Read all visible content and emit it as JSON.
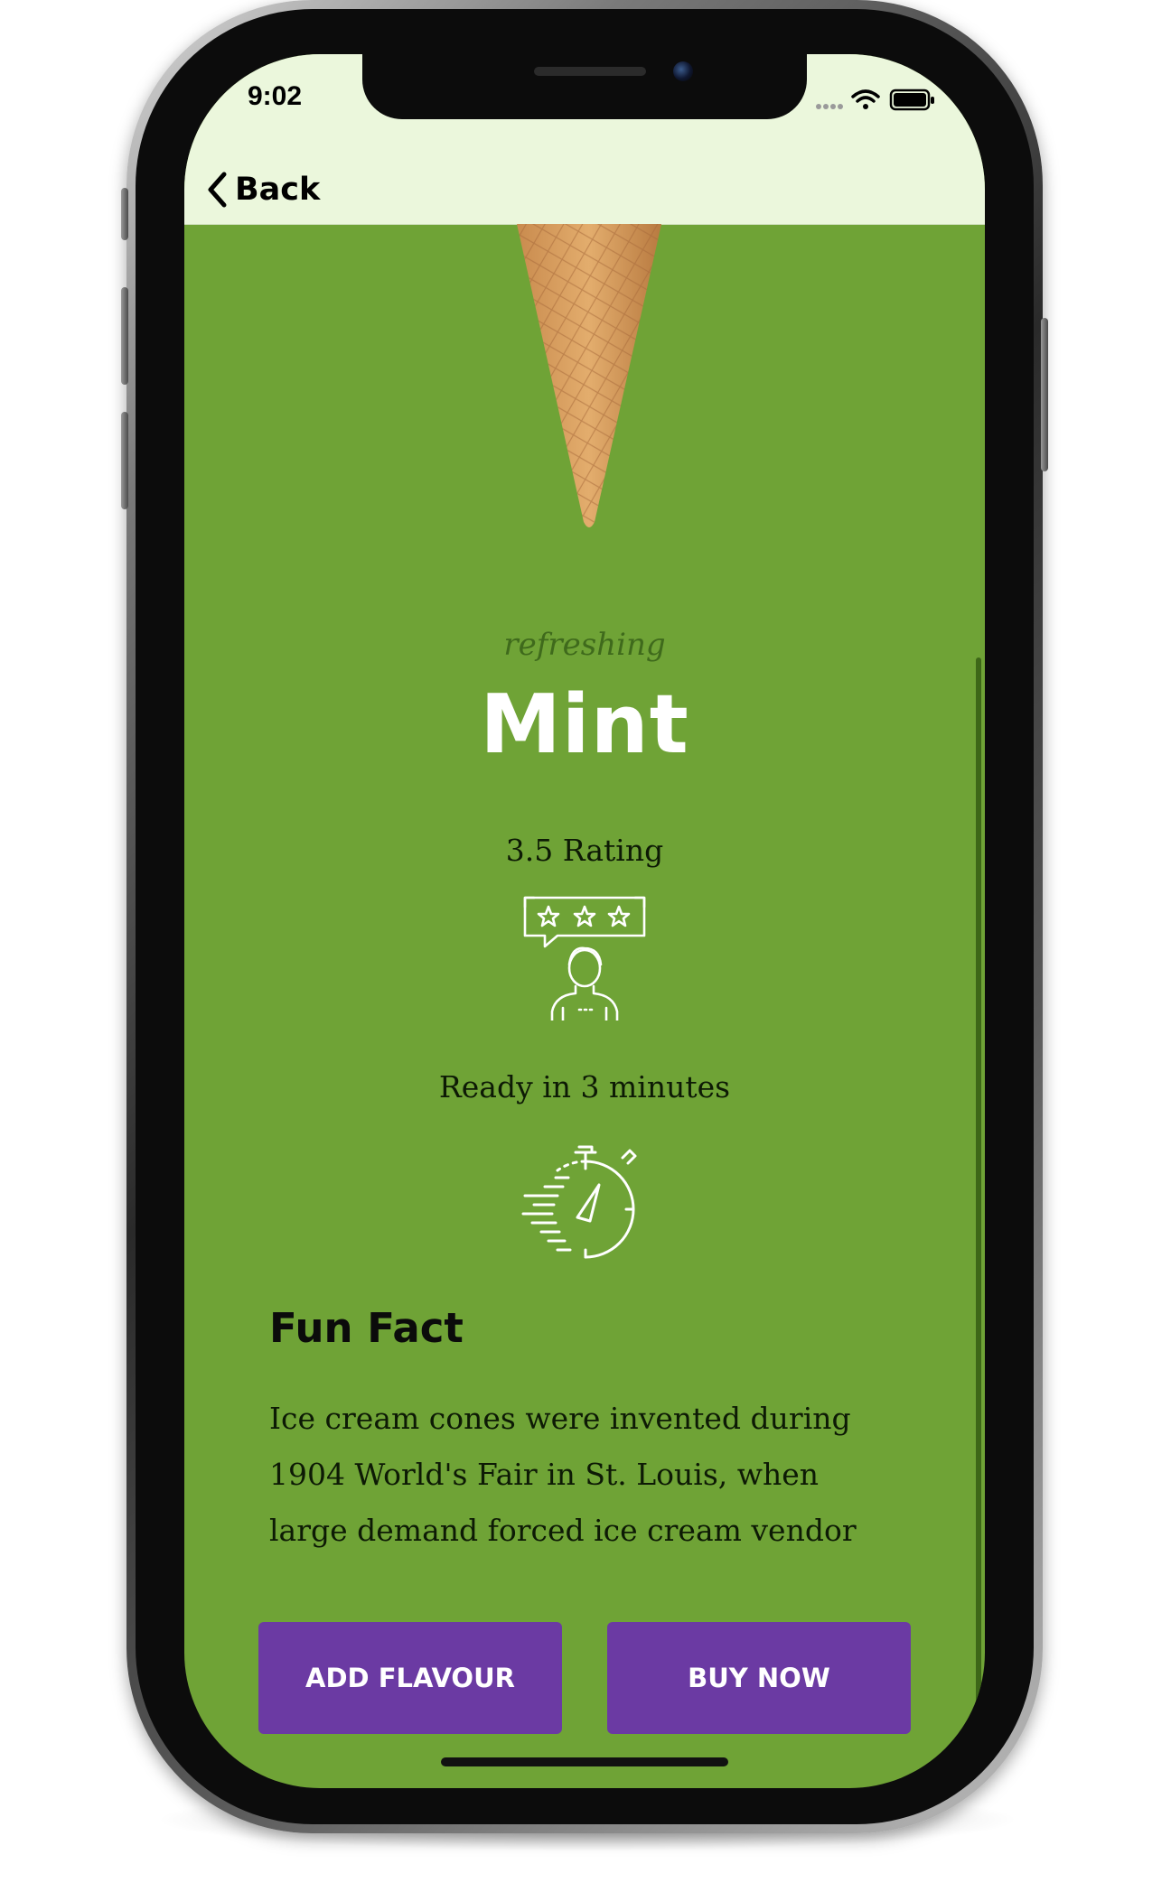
{
  "status_bar": {
    "time": "9:02",
    "icons": [
      "signal-dots-icon",
      "wifi-icon",
      "battery-icon"
    ]
  },
  "nav": {
    "back_label": "Back"
  },
  "product": {
    "subtitle": "refreshing",
    "title": "Mint",
    "rating_label": "3.5 Rating",
    "ready_label": "Ready in 3 minutes",
    "image": "ice-cream-cone-image"
  },
  "fun_fact": {
    "heading": "Fun Fact",
    "body": "Ice cream cones were invented during 1904 World's Fair in St. Louis, when large demand forced ice cream vendor"
  },
  "actions": {
    "add_label": "ADD FLAVOUR",
    "buy_label": "BUY NOW"
  },
  "colors": {
    "background": "#6fa336",
    "nav_background": "#ebf7dc",
    "button": "#6b3aa3",
    "button_text": "#ffffff",
    "title": "#ffffff"
  }
}
